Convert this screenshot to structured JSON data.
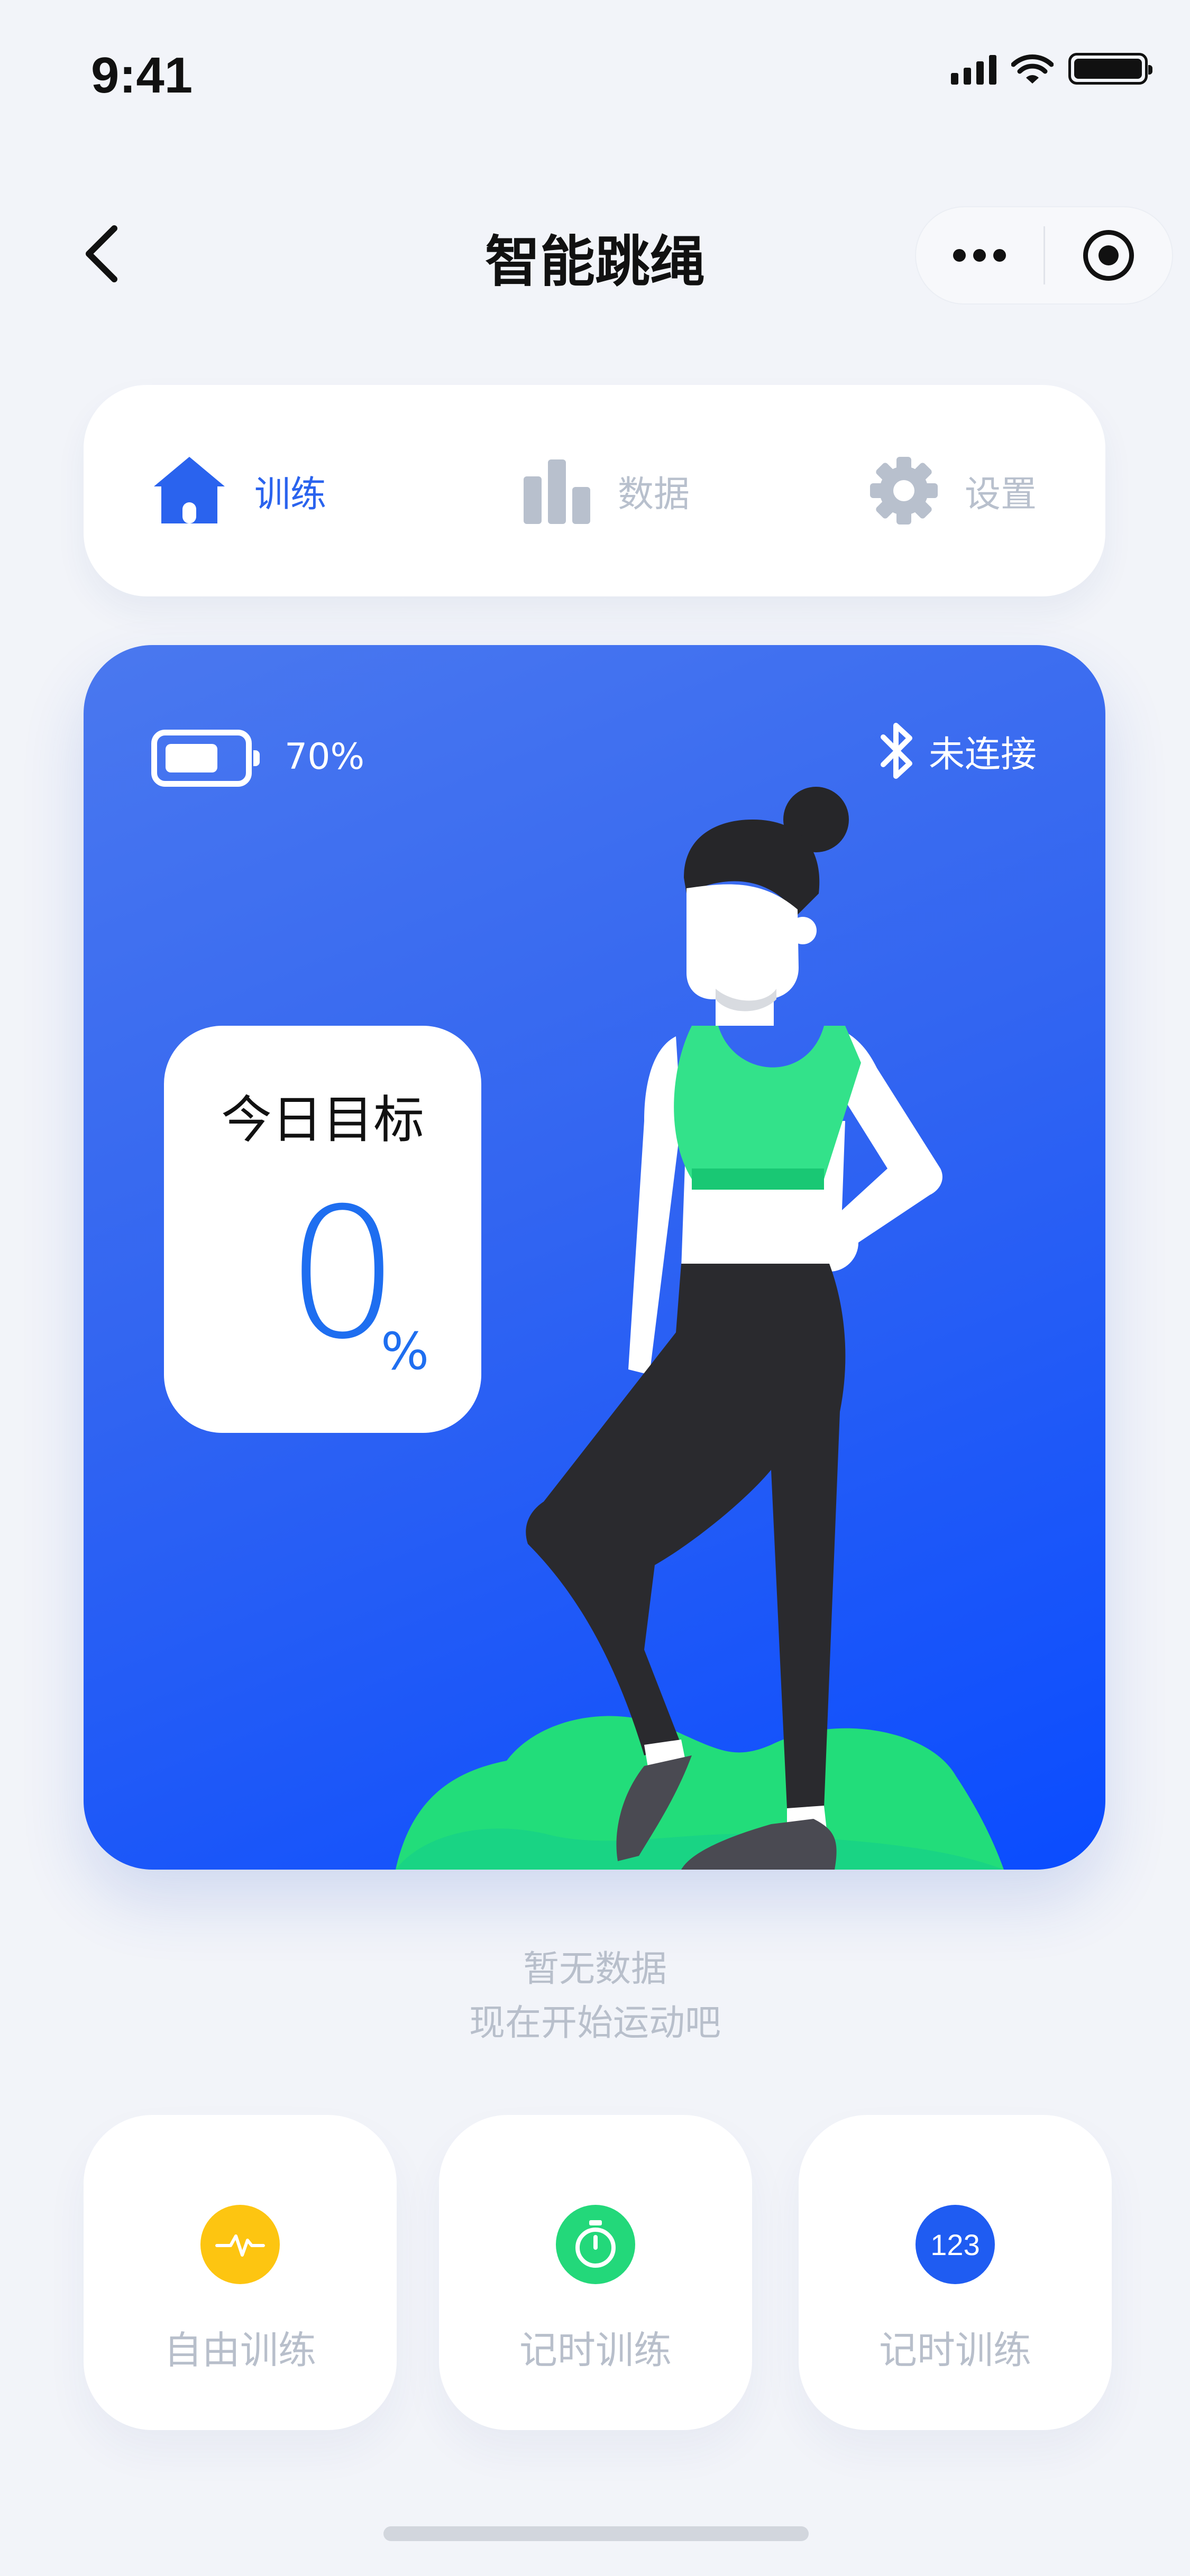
{
  "status_bar": {
    "time": "9:41",
    "icons": [
      "signal-icon",
      "wifi-icon",
      "battery-icon"
    ]
  },
  "nav": {
    "title": "智能跳绳",
    "back_icon": "chevron-left-icon",
    "menu_icons": [
      "more-dots-icon",
      "target-icon"
    ]
  },
  "tabs": [
    {
      "label": "训练",
      "icon": "home-icon",
      "active": true
    },
    {
      "label": "数据",
      "icon": "bar-chart-icon",
      "active": false
    },
    {
      "label": "设置",
      "icon": "gear-icon",
      "active": false
    }
  ],
  "hero": {
    "battery_percent": "70%",
    "battery_level": 0.7,
    "bluetooth_status": "未连接",
    "goal_title": "今日目标",
    "goal_value": "0",
    "goal_unit": "%"
  },
  "empty_state": {
    "line1": "暂无数据",
    "line2": "现在开始运动吧"
  },
  "modes": [
    {
      "label": "自由训练",
      "icon": "pulse-icon",
      "color": "#fdc511"
    },
    {
      "label": "记时训练",
      "icon": "stopwatch-icon",
      "color": "#23d87a"
    },
    {
      "label": "记时训练",
      "icon": "counter-icon",
      "icon_text": "123",
      "color": "#1f5cf2"
    }
  ],
  "colors": {
    "accent": "#2a63ee",
    "inactive": "#b8c0cd",
    "hero_start": "#4a78ef",
    "hero_end": "#0a4cff"
  }
}
